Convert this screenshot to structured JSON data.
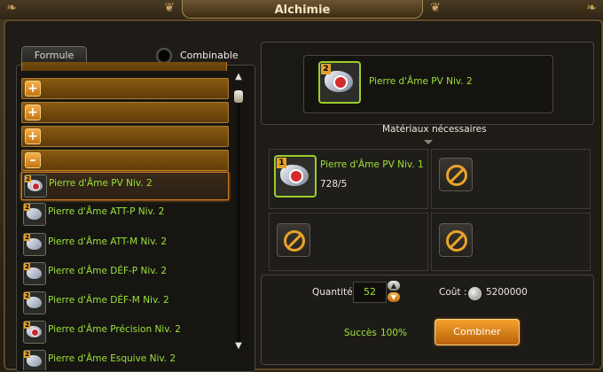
{
  "window": {
    "title": "Alchimie"
  },
  "left_panel": {
    "tab_label": "Formule",
    "toggle_label": "Combinable",
    "categories": [
      "+",
      "+",
      "+",
      "–"
    ],
    "items": [
      {
        "label": "Pierre d'Âme PV Niv. 2",
        "selected": true
      },
      {
        "label": "Pierre d'Âme ATT-P Niv. 2",
        "selected": false
      },
      {
        "label": "Pierre d'Âme ATT-M Niv. 2",
        "selected": false
      },
      {
        "label": "Pierre d'Âme DÉF-P Niv. 2",
        "selected": false
      },
      {
        "label": "Pierre d'Âme DÉF-M  Niv. 2",
        "selected": false
      },
      {
        "label": "Pierre d'Âme Précision Niv. 2",
        "selected": false
      },
      {
        "label": "Pierre d'Âme Esquive Niv. 2",
        "selected": false
      }
    ]
  },
  "result": {
    "icon_level": "2",
    "name": "Pierre d'Âme PV Niv. 2"
  },
  "materials": {
    "header": "Matériaux nécessaires",
    "slot1": {
      "icon_level": "1",
      "name": "Pierre d'Âme PV Niv. 1",
      "count": "728/5"
    }
  },
  "footer": {
    "quantity_label": "Quantité",
    "quantity_value": "52",
    "cost_label": "Coût :",
    "cost_value": "5200000",
    "success_label": "Succès",
    "success_value": "100%",
    "combine_button": "Combiner"
  },
  "colors": {
    "accent_green": "#9be23a",
    "button_orange": "#f4a22c"
  }
}
